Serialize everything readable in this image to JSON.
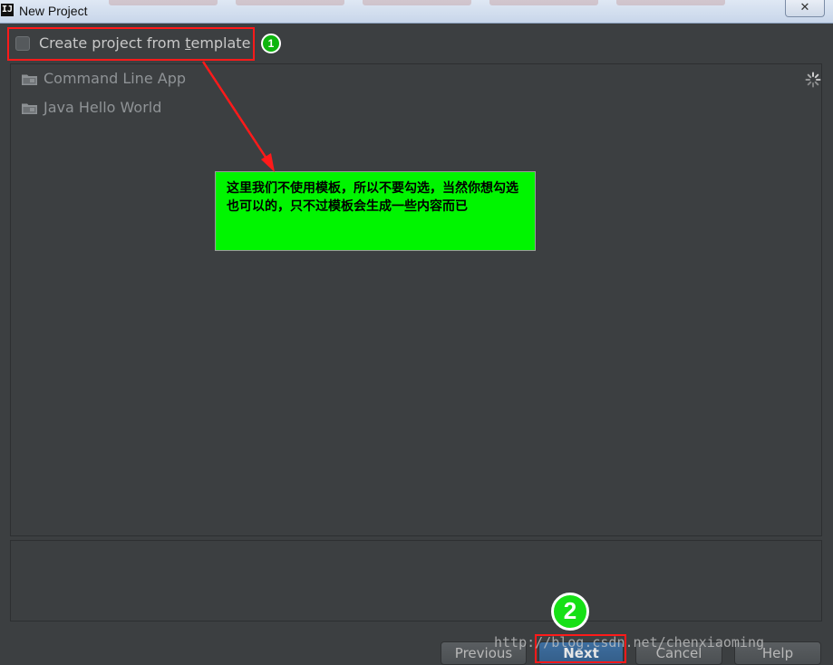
{
  "window": {
    "icon": "IJ",
    "title": "New Project",
    "close_glyph": "✕"
  },
  "template": {
    "checkbox_checked": false,
    "label_pre": "Create project from ",
    "label_mnemonic": "t",
    "label_post": "emplate"
  },
  "templates": [
    {
      "label": "Command Line App",
      "icon": "folder-icon"
    },
    {
      "label": "Java Hello World",
      "icon": "folder-icon"
    }
  ],
  "annotation": {
    "step1": "1",
    "step2": "2",
    "note": "这里我们不使用模板，所以不要勾选，当然你想勾选也可以的，只不过模板会生成一些内容而已",
    "note_color": "#00f500",
    "highlight_color": "#ff1a1a"
  },
  "buttons": {
    "previous": "Previous",
    "next": "Next",
    "cancel": "Cancel",
    "help": "Help"
  },
  "watermark": "http://blog.csdn.net/chenxiaoming"
}
